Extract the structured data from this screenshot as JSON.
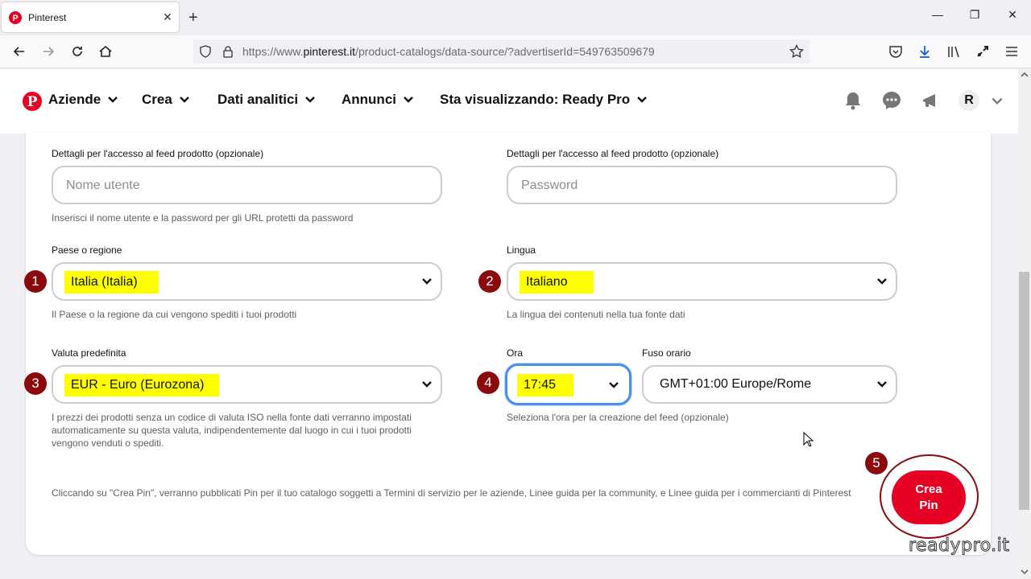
{
  "browser": {
    "tab_title": "Pinterest",
    "new_tab": "+",
    "url_prefix": "https://www.",
    "url_domain": "pinterest.it",
    "url_path": "/product-catalogs/data-source/?advertiserId=549763509679"
  },
  "header": {
    "nav": [
      "Aziende",
      "Crea",
      "Dati analitici",
      "Annunci",
      "Sta visualizzando: Ready Pro"
    ],
    "avatar_initial": "R"
  },
  "form": {
    "user_label": "Dettagli per l'accesso al feed prodotto (opzionale)",
    "user_placeholder": "Nome utente",
    "pass_label": "Dettagli per l'accesso al feed prodotto (opzionale)",
    "pass_placeholder": "Password",
    "auth_help": "Inserisci il nome utente e la password per gli URL protetti da password",
    "country_label": "Paese o regione",
    "country_value": "Italia (Italia)",
    "country_help": "Il Paese o la regione da cui vengono spediti i tuoi prodotti",
    "language_label": "Lingua",
    "language_value": "Italiano",
    "language_help": "La lingua dei contenuti nella tua fonte dati",
    "currency_label": "Valuta predefinita",
    "currency_value": "EUR - Euro (Eurozona)",
    "currency_help": "I prezzi dei prodotti senza un codice di valuta ISO nella fonte dati verranno impostati automaticamente su questa valuta, indipendentemente dal luogo in cui i tuoi prodotti vengono venduti o spediti.",
    "time_label": "Ora",
    "time_value": "17:45",
    "tz_label": "Fuso orario",
    "tz_value": "GMT+01:00 Europe/Rome",
    "time_help": "Seleziona l'ora per la creazione del feed (opzionale)",
    "terms": "Cliccando su \"Crea Pin\", verranno pubblicati Pin per il tuo catalogo soggetti a Termini di servizio per le aziende, Linee guida per la community, e Linee guida per i commercianti di Pinterest",
    "submit": "Crea Pin"
  },
  "annotations": [
    "1",
    "2",
    "3",
    "4",
    "5"
  ],
  "watermark": "readypro.it",
  "colors": {
    "pinterest_red": "#e60023",
    "highlight": "#ffff00",
    "annotation": "#8b0a0e",
    "focus": "#4a8ff3"
  }
}
